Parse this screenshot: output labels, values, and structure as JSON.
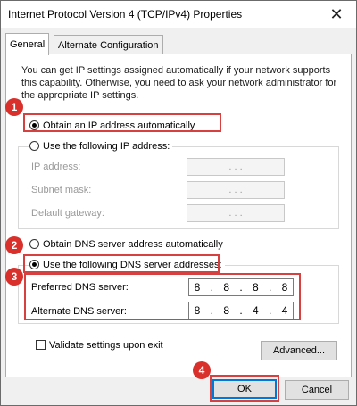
{
  "window": {
    "title": "Internet Protocol Version 4 (TCP/IPv4) Properties",
    "close_glyph": "✕"
  },
  "tabs": [
    {
      "label": "General"
    },
    {
      "label": "Alternate Configuration"
    }
  ],
  "description": "You can get IP settings assigned automatically if your network supports this capability. Otherwise, you need to ask your network administrator for the appropriate IP settings.",
  "ip": {
    "auto_label": "Obtain an IP address automatically",
    "manual_label": "Use the following IP address:",
    "fields": [
      {
        "label": "IP address:",
        "value": ". . ."
      },
      {
        "label": "Subnet mask:",
        "value": ". . ."
      },
      {
        "label": "Default gateway:",
        "value": ". . ."
      }
    ]
  },
  "dns": {
    "auto_label": "Obtain DNS server address automatically",
    "manual_label": "Use the following DNS server addresses:",
    "preferred": {
      "label": "Preferred DNS server:",
      "octets": [
        "8",
        "8",
        "8",
        "8"
      ]
    },
    "alternate": {
      "label": "Alternate DNS server:",
      "octets": [
        "8",
        "8",
        "4",
        "4"
      ]
    }
  },
  "validate_label": "Validate settings upon exit",
  "buttons": {
    "advanced": "Advanced...",
    "ok": "OK",
    "cancel": "Cancel"
  },
  "badges": [
    "1",
    "2",
    "3",
    "4"
  ],
  "colors": {
    "highlight": "#d64040",
    "badge": "#d9302c",
    "focus": "#0078d7"
  }
}
